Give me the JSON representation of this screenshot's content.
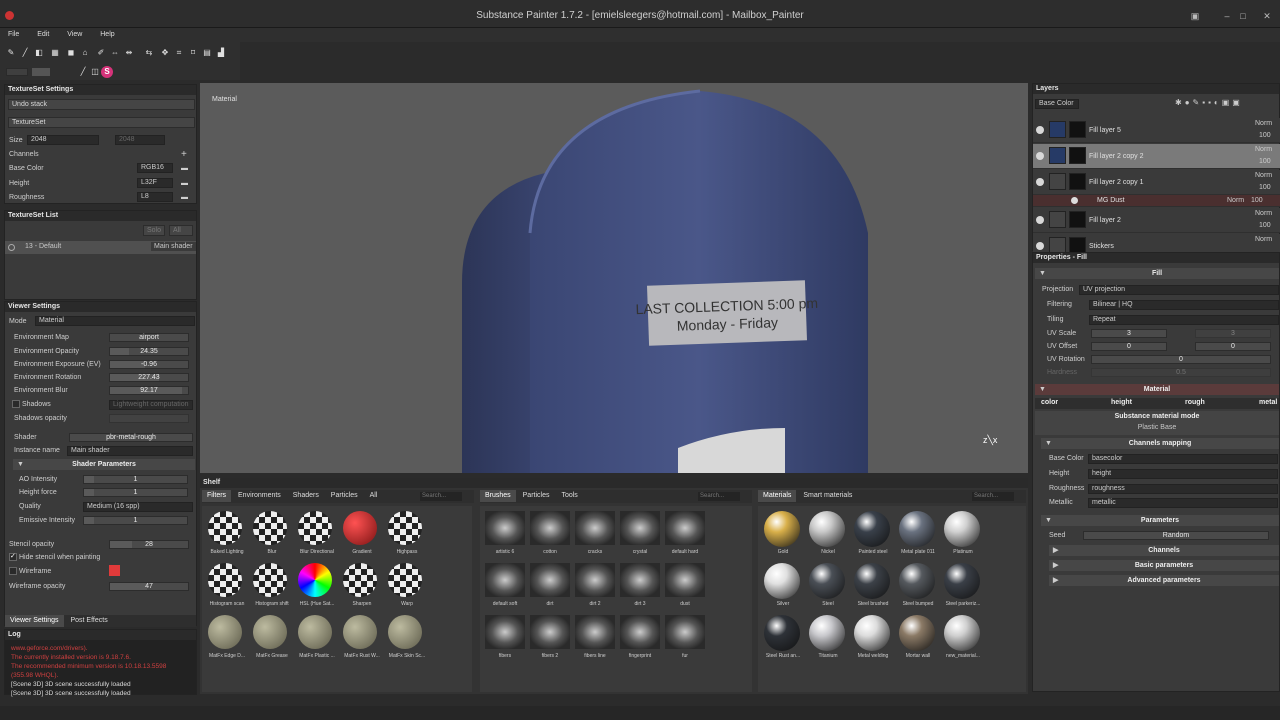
{
  "window": {
    "title": "Substance Painter 1.7.2 - [emielsleegers@hotmail.com] - Mailbox_Painter"
  },
  "menu": [
    "File",
    "Edit",
    "View",
    "Help"
  ],
  "textureset_settings": {
    "title": "TextureSet Settings",
    "undo_stack": "Undo stack",
    "textureset": "TextureSet",
    "size_label": "Size",
    "size_value": "2048",
    "size_value2": "2048",
    "channels_label": "Channels",
    "channels": [
      {
        "name": "Base Color",
        "format": "RGB16"
      },
      {
        "name": "Height",
        "format": "L32F"
      },
      {
        "name": "Roughness",
        "format": "L8"
      }
    ]
  },
  "textureset_list": {
    "title": "TextureSet List",
    "solo": "Solo",
    "all": "All",
    "item": "13 - Default",
    "shader": "Main shader"
  },
  "viewer_settings": {
    "title": "Viewer Settings",
    "mode_label": "Mode",
    "mode_value": "Material",
    "rows": [
      {
        "label": "Environment Map",
        "value": "airport"
      },
      {
        "label": "Environment Opacity",
        "value": "24.35"
      },
      {
        "label": "Environment Exposure (EV)",
        "value": "-0.96"
      },
      {
        "label": "Environment Rotation",
        "value": "227.43"
      },
      {
        "label": "Environment Blur",
        "value": "92.17"
      }
    ],
    "shadows_label": "Shadows",
    "shadows_value": "Lightweight computation",
    "shadows_opacity_label": "Shadows opacity",
    "shader_label": "Shader",
    "shader_value": "pbr-metal-rough",
    "instance_label": "Instance name",
    "instance_value": "Main shader",
    "shader_params_title": "Shader Parameters",
    "params": [
      {
        "label": "AO Intensity",
        "value": "1"
      },
      {
        "label": "Height force",
        "value": "1"
      },
      {
        "label": "Quality",
        "value": "Medium (16 spp)"
      },
      {
        "label": "Emissive Intensity",
        "value": "1"
      }
    ],
    "stencil_label": "Stencil opacity",
    "stencil_value": "28",
    "hide_stencil": "Hide stencil when painting",
    "wireframe": "Wireframe",
    "wireframe_opacity_label": "Wireframe opacity",
    "wireframe_opacity_value": "47",
    "tabs": [
      "Viewer Settings",
      "Post Effects"
    ]
  },
  "log": {
    "title": "Log",
    "lines": [
      {
        "text": "www.geforce.com/drivers).",
        "color": "#d04040"
      },
      {
        "text": "The currently installed version is 9.18.7.6.",
        "color": "#d04040"
      },
      {
        "text": "The recommended minimum version is 10.18.13.5598",
        "color": "#d04040"
      },
      {
        "text": "(355.98 WHQL).",
        "color": "#d04040"
      },
      {
        "text": "[Scene 3D] 3D scene successfully loaded",
        "color": "#dcdcdc"
      },
      {
        "text": "[Scene 3D] 3D scene successfully loaded",
        "color": "#dcdcdc"
      }
    ]
  },
  "viewport": {
    "label": "Material",
    "mailbox_text1": "LAST COLLECTION 5:00 pm",
    "mailbox_text2": "Monday - Friday"
  },
  "shelf": {
    "title": "Shelf",
    "tabs": [
      "Filters",
      "Environments",
      "Shaders",
      "Particles",
      "All"
    ],
    "search": "Search...",
    "filters": [
      "Baked Lighting",
      "Blur",
      "Blur Directional",
      "Gradient",
      "Highpass",
      "Histogram scan",
      "Histogram shift",
      "HSL (Hue Sat...",
      "Sharpen",
      "Warp",
      "MatFx Edge D...",
      "MatFx Grease",
      "MatFx Plastic ...",
      "MatFx Rust W...",
      "MatFx Skin Sc..."
    ],
    "brush_tabs": [
      "Brushes",
      "Particles",
      "Tools"
    ],
    "brushes": [
      "artistic 6",
      "cotton",
      "cracks",
      "crystal",
      "default hard",
      "default soft",
      "dirt",
      "dirt 2",
      "dirt 3",
      "dust",
      "fibers",
      "fibers 2",
      "fibers line",
      "fingerprint",
      "fur"
    ],
    "material_tabs": [
      "Materials",
      "Smart materials"
    ],
    "materials": [
      "Gold",
      "Nickel",
      "Painted steel",
      "Metal plate 011",
      "Platinum",
      "Silver",
      "Steel",
      "Steel brushed",
      "Steel bumped",
      "Steel parkeriz...",
      "Steel Rust an...",
      "Titanium",
      "Metal welding",
      "Mortar wall",
      "new_material..."
    ]
  },
  "layers": {
    "title": "Layers",
    "channel": "Base Color",
    "items": [
      {
        "name": "Fill layer 5",
        "blend": "Norm",
        "opacity": "100"
      },
      {
        "name": "Fill layer 2 copy 2",
        "blend": "Norm",
        "opacity": "100"
      },
      {
        "name": "Fill layer 2 copy 1",
        "blend": "Norm",
        "opacity": "100"
      },
      {
        "name": "MG Dust",
        "blend": "Norm",
        "opacity": "100"
      },
      {
        "name": "Fill layer 2",
        "blend": "Norm",
        "opacity": "100"
      },
      {
        "name": "Stickers",
        "blend": "Norm",
        "opacity": ""
      }
    ]
  },
  "properties": {
    "title": "Properties - Fill",
    "fill_header": "Fill",
    "rows": [
      {
        "label": "Projection",
        "value": "UV projection"
      },
      {
        "label": "Filtering",
        "value": "Bilinear | HQ"
      },
      {
        "label": "Tiling",
        "value": "Repeat"
      }
    ],
    "uv_scale_label": "UV Scale",
    "uv_scale": "3",
    "uv_scale2": "3",
    "uv_offset_label": "UV Offset",
    "uv_offset": "0",
    "uv_offset2": "0",
    "uv_rotation_label": "UV Rotation",
    "uv_rotation": "0",
    "hardness_label": "Hardness",
    "hardness": "0.5",
    "material_header": "Material",
    "material_tabs": [
      "color",
      "height",
      "rough",
      "metal"
    ],
    "sub_mode": "Substance material mode",
    "sub_mode_value": "Plastic Base",
    "channels_mapping": "Channels mapping",
    "mapping": [
      {
        "label": "Base Color",
        "value": "basecolor"
      },
      {
        "label": "Height",
        "value": "height"
      },
      {
        "label": "Roughness",
        "value": "roughness"
      },
      {
        "label": "Metallic",
        "value": "metallic"
      }
    ],
    "parameters": "Parameters",
    "seed_label": "Seed",
    "seed_value": "Random",
    "channels": "Channels",
    "basic_params": "Basic parameters",
    "advanced_params": "Advanced parameters"
  }
}
